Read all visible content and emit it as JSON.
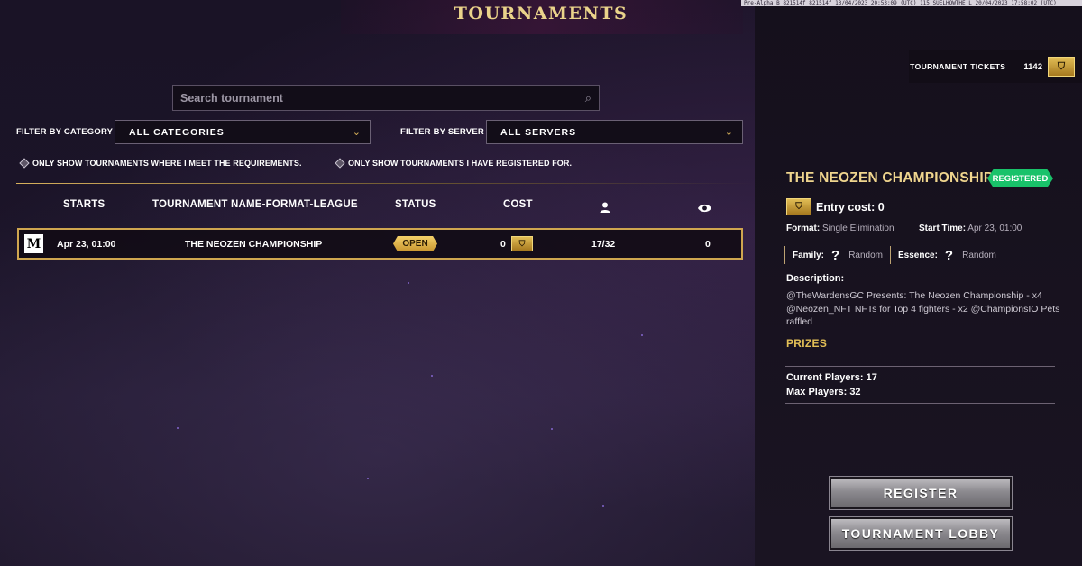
{
  "header": {
    "title": "TOURNAMENTS",
    "build_info": "Pre-Alpha B 821514f 821514f 13/04/2023 20:53:09 (UTC) 115 SUELHOWTHE L 20/04/2023 17:58:02 (UTC)"
  },
  "tickets": {
    "label": "TOURNAMENT TICKETS",
    "count": "1142",
    "icon": "ticket-icon"
  },
  "search": {
    "placeholder": "Search tournament",
    "value": ""
  },
  "filters": {
    "category_label": "FILTER BY CATEGORY",
    "category_value": "ALL CATEGORIES",
    "server_label": "FILTER BY SERVER",
    "server_value": "ALL SERVERS",
    "meet_requirements": "ONLY SHOW TOURNAMENTS WHERE I MEET THE REQUIREMENTS.",
    "registered_only": "ONLY SHOW TOURNAMENTS I HAVE REGISTERED FOR."
  },
  "table": {
    "headers": {
      "starts": "STARTS",
      "name": "TOURNAMENT NAME-FORMAT-LEAGUE",
      "status": "STATUS",
      "cost": "COST",
      "players_icon": "user-icon",
      "spectators_icon": "eye-icon"
    },
    "rows": [
      {
        "league_badge": "M",
        "starts": "Apr 23, 01:00",
        "name": "THE NEOZEN CHAMPIONSHIP",
        "status": "OPEN",
        "cost": "0",
        "players": "17/32",
        "spectators": "0"
      }
    ]
  },
  "details": {
    "title": "THE NEOZEN CHAMPIONSHIP",
    "badge": "REGISTERED",
    "entry_cost": "Entry cost: 0",
    "format_label": "Format:",
    "format_value": "Single Elimination",
    "start_label": "Start Time:",
    "start_value": "Apr 23, 01:00",
    "family_label": "Family:",
    "family_value": "Random",
    "essence_label": "Essence:",
    "essence_value": "Random",
    "description_label": "Description:",
    "description": "@TheWardensGC  Presents: The Neozen Championship - x4 @Neozen_NFT NFTs for Top 4 fighters - x2 @ChampionsIO Pets raffled",
    "prizes_label": "PRIZES",
    "current_players": "Current Players: 17",
    "max_players": "Max Players: 32"
  },
  "actions": {
    "register": "REGISTER",
    "lobby": "TOURNAMENT LOBBY"
  },
  "colors": {
    "accent_gold": "#e3bf56",
    "registered_green": "#19c26a",
    "row_border": "#cfa64f"
  }
}
